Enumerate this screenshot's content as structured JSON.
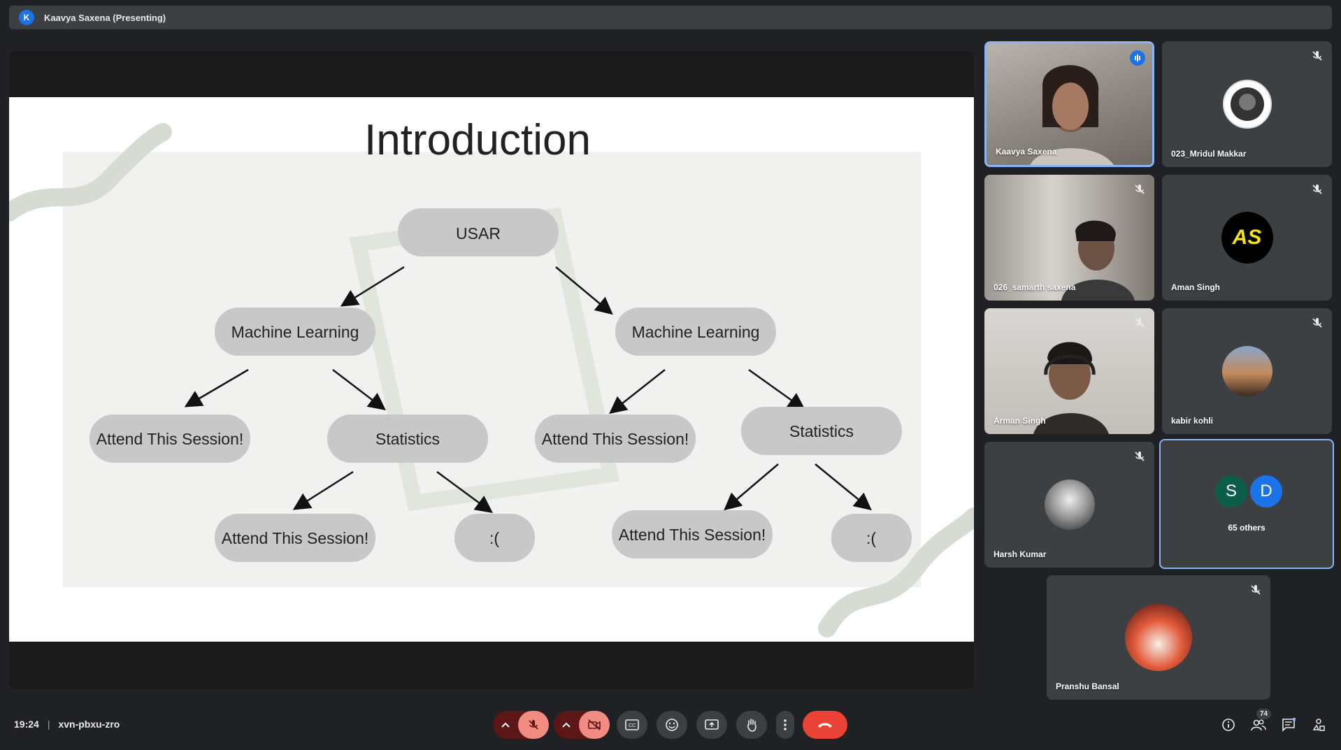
{
  "presenter_bar": {
    "avatar_letter": "K",
    "title": "Kaavya Saxena (Presenting)"
  },
  "slide": {
    "title": "Introduction",
    "nodes": {
      "root": "USAR",
      "ml_left": "Machine Learning",
      "ml_right": "Machine Learning",
      "attend_1": "Attend This Session!",
      "stats_left": "Statistics",
      "attend_2": "Attend This Session!",
      "stats_right": "Statistics",
      "attend_3": "Attend This Session!",
      "sad_1": ":(",
      "attend_4": "Attend This Session!",
      "sad_2": ":("
    }
  },
  "participants": [
    {
      "name": "Kaavya Saxena",
      "state": "speaking"
    },
    {
      "name": "023_Mridul Makkar",
      "state": "muted"
    },
    {
      "name": "026_samarth saxena",
      "state": "muted"
    },
    {
      "name": "Aman Singh",
      "state": "muted",
      "avatar_text": "AS"
    },
    {
      "name": "Arman Singh",
      "state": "muted"
    },
    {
      "name": "kabir kohli",
      "state": "muted"
    },
    {
      "name": "Harsh Kumar",
      "state": "muted"
    },
    {
      "name": "65 others",
      "avatars": [
        "S",
        "D"
      ]
    },
    {
      "name": "Pranshu Bansal",
      "state": "muted"
    }
  ],
  "bottom": {
    "time": "19:24",
    "separator": "|",
    "meeting_code": "xvn-pbxu-zro",
    "participant_count": "74"
  },
  "colors": {
    "accent": "#8ab4f8",
    "hangup": "#ea4335",
    "muted_bg": "#f28b82"
  }
}
